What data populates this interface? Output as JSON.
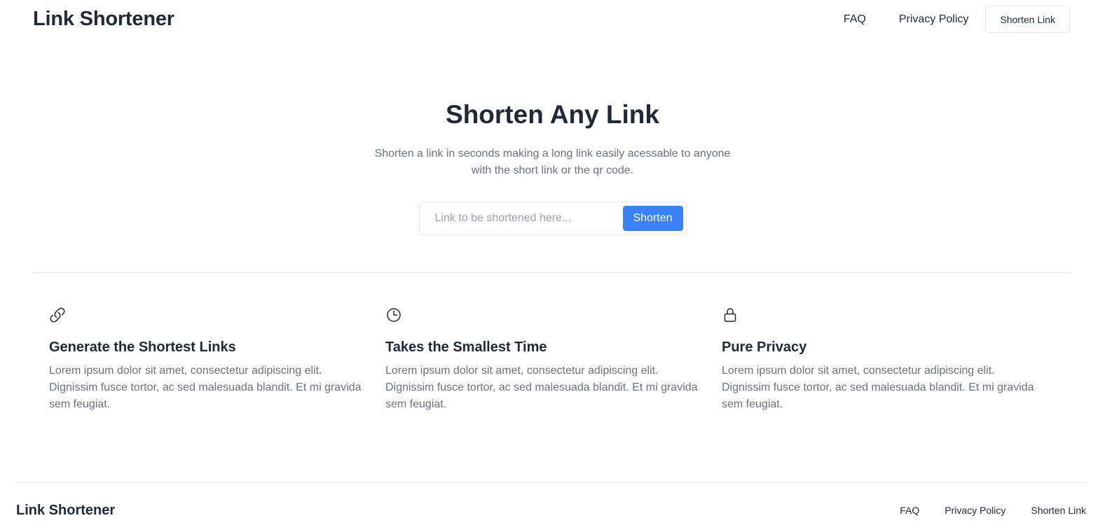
{
  "header": {
    "brand": "Link Shortener",
    "nav": {
      "faq": "FAQ",
      "privacy": "Privacy Policy",
      "shorten_button": "Shorten Link"
    }
  },
  "hero": {
    "title": "Shorten Any Link",
    "subtitle": "Shorten a link in seconds making a long link easily acessable to anyone with the short link or the qr code.",
    "input_placeholder": "Link to be shortened here...",
    "input_value": "",
    "submit_label": "Shorten"
  },
  "features": [
    {
      "icon": "link-icon",
      "title": "Generate the Shortest Links",
      "text": "Lorem ipsum dolor sit amet, consectetur adipiscing elit. Dignissim fusce tortor, ac sed malesuada blandit. Et mi gravida sem feugiat."
    },
    {
      "icon": "clock-icon",
      "title": "Takes the Smallest Time",
      "text": "Lorem ipsum dolor sit amet, consectetur adipiscing elit. Dignissim fusce tortor, ac sed malesuada blandit. Et mi gravida sem feugiat."
    },
    {
      "icon": "lock-icon",
      "title": "Pure Privacy",
      "text": "Lorem ipsum dolor sit amet, consectetur adipiscing elit. Dignissim fusce tortor, ac sed malesuada blandit. Et mi gravida sem feugiat."
    }
  ],
  "footer": {
    "brand": "Link Shortener",
    "links": {
      "faq": "FAQ",
      "privacy": "Privacy Policy",
      "shorten": "Shorten Link"
    }
  },
  "colors": {
    "accent": "#3b82f6",
    "text": "#1f2937",
    "muted": "#6b7280",
    "border": "#e5e7eb"
  }
}
